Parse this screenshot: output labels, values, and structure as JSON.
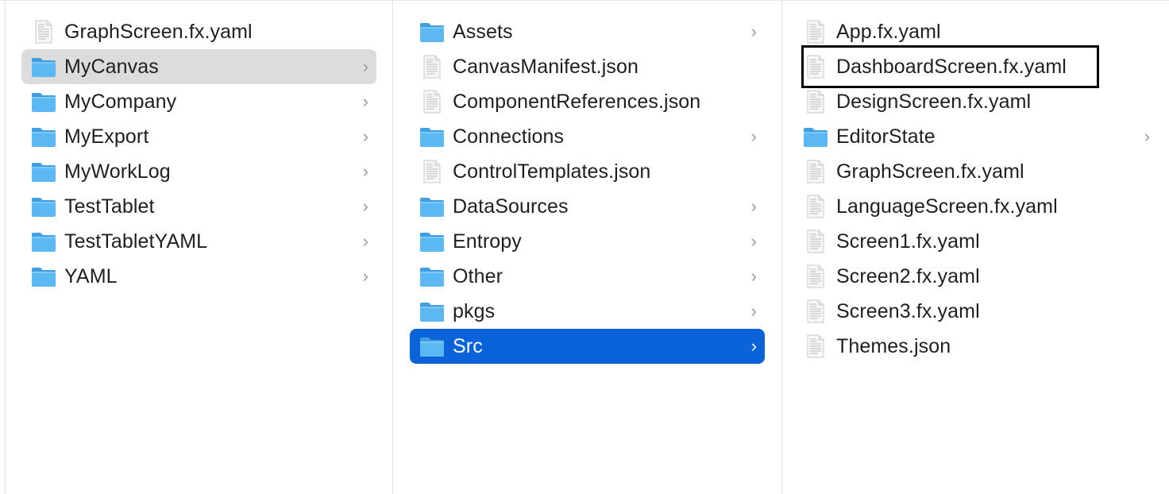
{
  "columns": [
    {
      "items": [
        {
          "label": "GraphScreen.fx.yaml",
          "icon": "file-icon",
          "kind": "file"
        },
        {
          "label": "MyCanvas",
          "icon": "folder-icon",
          "kind": "folder",
          "selected": "gray"
        },
        {
          "label": "MyCompany",
          "icon": "folder-icon",
          "kind": "folder"
        },
        {
          "label": "MyExport",
          "icon": "folder-icon",
          "kind": "folder"
        },
        {
          "label": "MyWorkLog",
          "icon": "folder-icon",
          "kind": "folder"
        },
        {
          "label": "TestTablet",
          "icon": "folder-icon",
          "kind": "folder"
        },
        {
          "label": "TestTabletYAML",
          "icon": "folder-icon",
          "kind": "folder"
        },
        {
          "label": "YAML",
          "icon": "folder-icon",
          "kind": "folder"
        }
      ]
    },
    {
      "items": [
        {
          "label": "Assets",
          "icon": "folder-icon",
          "kind": "folder"
        },
        {
          "label": "CanvasManifest.json",
          "icon": "file-icon",
          "kind": "file"
        },
        {
          "label": "ComponentReferences.json",
          "icon": "file-icon",
          "kind": "file"
        },
        {
          "label": "Connections",
          "icon": "folder-icon",
          "kind": "folder"
        },
        {
          "label": "ControlTemplates.json",
          "icon": "file-icon",
          "kind": "file"
        },
        {
          "label": "DataSources",
          "icon": "folder-icon",
          "kind": "folder"
        },
        {
          "label": "Entropy",
          "icon": "folder-icon",
          "kind": "folder"
        },
        {
          "label": "Other",
          "icon": "folder-icon",
          "kind": "folder"
        },
        {
          "label": "pkgs",
          "icon": "folder-icon",
          "kind": "folder"
        },
        {
          "label": "Src",
          "icon": "folder-icon",
          "kind": "folder",
          "selected": "blue"
        }
      ]
    },
    {
      "items": [
        {
          "label": "App.fx.yaml",
          "icon": "file-icon",
          "kind": "file"
        },
        {
          "label": "DashboardScreen.fx.yaml",
          "icon": "file-icon",
          "kind": "file",
          "outlined": true
        },
        {
          "label": "DesignScreen.fx.yaml",
          "icon": "file-icon",
          "kind": "file"
        },
        {
          "label": "EditorState",
          "icon": "folder-icon",
          "kind": "folder"
        },
        {
          "label": "GraphScreen.fx.yaml",
          "icon": "file-icon",
          "kind": "file"
        },
        {
          "label": "LanguageScreen.fx.yaml",
          "icon": "file-icon",
          "kind": "file"
        },
        {
          "label": "Screen1.fx.yaml",
          "icon": "file-icon",
          "kind": "file"
        },
        {
          "label": "Screen2.fx.yaml",
          "icon": "file-icon",
          "kind": "file"
        },
        {
          "label": "Screen3.fx.yaml",
          "icon": "file-icon",
          "kind": "file"
        },
        {
          "label": "Themes.json",
          "icon": "file-icon",
          "kind": "file"
        }
      ]
    }
  ],
  "chevron_glyph": "›",
  "colors": {
    "selection_blue": "#0a63d8",
    "selection_gray": "#dcdcdc",
    "folder_blue": "#5cb8f2",
    "folder_tab": "#3f9fe0",
    "outline": "#000000"
  }
}
